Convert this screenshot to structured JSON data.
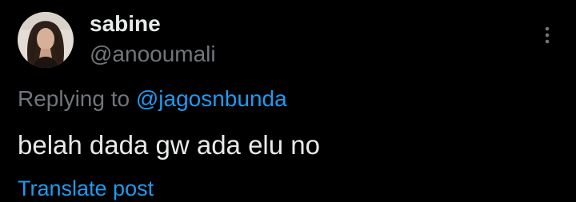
{
  "author": {
    "display_name": "sabine",
    "handle": "@anooumali",
    "avatar_icon": "profile-photo"
  },
  "more_icon": "more-vertical-icon",
  "reply": {
    "prefix": "Replying to",
    "target": "@jagosnbunda"
  },
  "post": {
    "text": "belah dada gw ada elu no"
  },
  "translate_label": "Translate post",
  "colors": {
    "background": "#000000",
    "primary_text": "#e7e9ea",
    "secondary_text": "#71767b",
    "accent": "#1d9bf0"
  }
}
